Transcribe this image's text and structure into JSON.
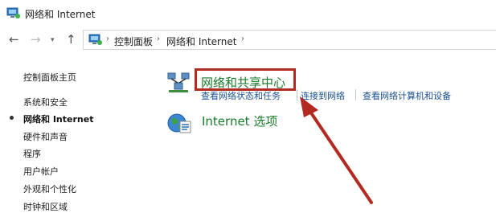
{
  "window": {
    "title": "网络和 Internet"
  },
  "nav": {
    "back_glyph": "←",
    "forward_glyph": "→",
    "dropdown_glyph": "▾",
    "up_glyph": "↑"
  },
  "address_bar": {
    "separator": "›",
    "crumbs": [
      "控制面板",
      "网络和 Internet"
    ]
  },
  "sidebar": {
    "items": [
      {
        "label": "控制面板主页"
      },
      {
        "label": "系统和安全"
      },
      {
        "label": "网络和 Internet",
        "active": true
      },
      {
        "label": "硬件和声音"
      },
      {
        "label": "程序"
      },
      {
        "label": "用户帐户"
      },
      {
        "label": "外观和个性化"
      },
      {
        "label": "时钟和区域"
      }
    ]
  },
  "main": {
    "categories": [
      {
        "title": "网络和共享中心",
        "icon": "network-sharing-icon",
        "links": [
          "查看网络状态和任务",
          "连接到网络",
          "查看网络计算机和设备"
        ]
      },
      {
        "title": "Internet 选项",
        "icon": "internet-options-icon",
        "links": []
      }
    ]
  },
  "annotation": {
    "color": "#b32a20"
  },
  "colors": {
    "link": "#1b4f93",
    "category_title": "#1a7a2b",
    "window_bg": "#ffffff"
  }
}
